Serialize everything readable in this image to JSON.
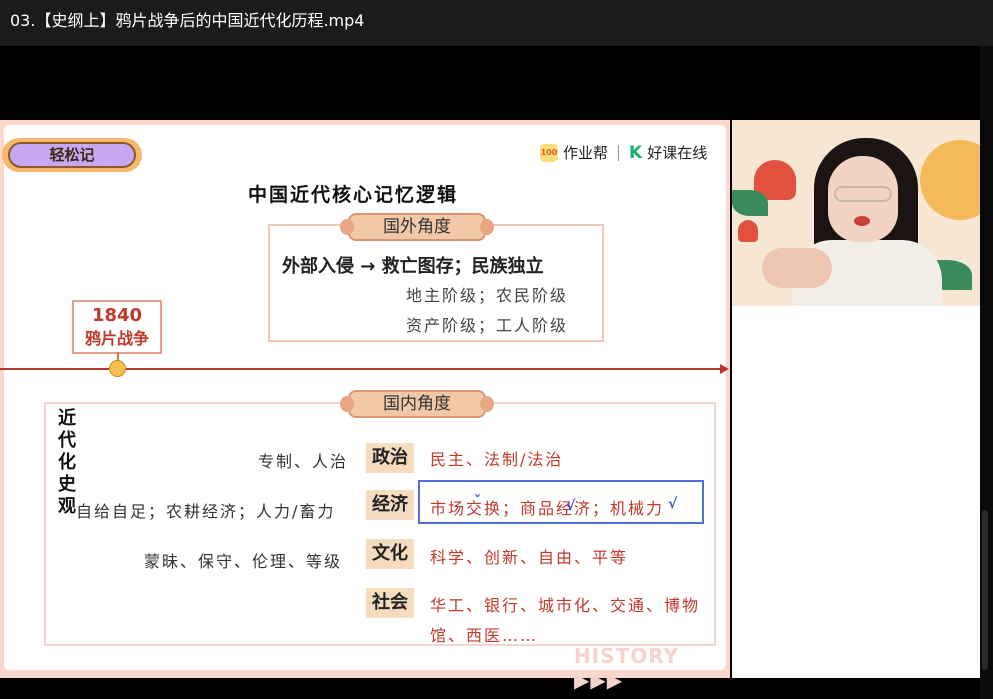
{
  "window": {
    "title": "03.【史纲上】鸦片战争后的中国近代化历程.mp4"
  },
  "slide": {
    "badge": "轻松记",
    "brand": {
      "left": "作业帮",
      "right": "好课在线",
      "logo1": "100"
    },
    "title": "中国近代核心记忆逻辑",
    "foreign": {
      "tag": "国外角度",
      "main": "外部入侵 → 救亡图存；民族独立",
      "sub1": "地主阶级；农民阶级",
      "sub2": "资产阶级；工人阶级"
    },
    "timeline": {
      "year": "1840",
      "event": "鸦片战争"
    },
    "domestic": {
      "tag": "国内角度",
      "side_label": "近代化史观",
      "rows": [
        {
          "left": "专制、人治",
          "category": "政治",
          "right": "民主、法制/法治"
        },
        {
          "left": "自给自足；农耕经济；人力/畜力",
          "category": "经济",
          "right": "市场交换；商品经济；机械力"
        },
        {
          "left": "蒙昧、保守、伦理、等级",
          "category": "文化",
          "right": "科学、创新、自由、平等"
        },
        {
          "left": "",
          "category": "社会",
          "right": "华工、银行、城市化、交通、博物",
          "right2": "馆、西医……"
        }
      ]
    },
    "watermark": "HISTORY ▶▶▶"
  },
  "colors": {
    "accent": "#c0392b",
    "highlight": "#4d6fd6",
    "slide_bg": "#fbd7cc"
  }
}
